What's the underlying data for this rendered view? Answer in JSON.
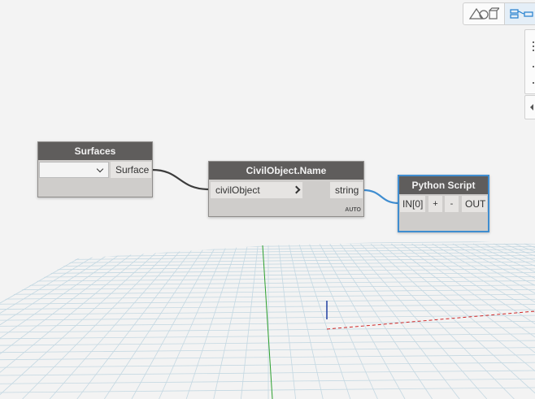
{
  "view_toggle": {
    "geometry_icon": "geometry-shapes-icon",
    "graph_icon": "graph-nodes-icon",
    "active": "graph"
  },
  "nodes": {
    "surfaces": {
      "title": "Surfaces",
      "dropdown_value": "",
      "output_port": "Surface"
    },
    "civil_object_name": {
      "title": "CivilObject.Name",
      "input_port": "civilObject",
      "output_port": "string",
      "lacing": "AUTO"
    },
    "python_script": {
      "title": "Python Script",
      "input_port": "IN[0]",
      "add_label": "+",
      "remove_label": "-",
      "output_port": "OUT"
    }
  },
  "colors": {
    "node_header": "#5f5d5c",
    "node_body": "#cfcdcb",
    "selection": "#3f8dd0",
    "wire_default": "#3c3c3c",
    "wire_selected": "#3f8dd0",
    "grid": "#c4d8e2",
    "axis_x": "#d02828",
    "axis_y": "#1f3fa0",
    "axis_z": "#2da02d"
  }
}
